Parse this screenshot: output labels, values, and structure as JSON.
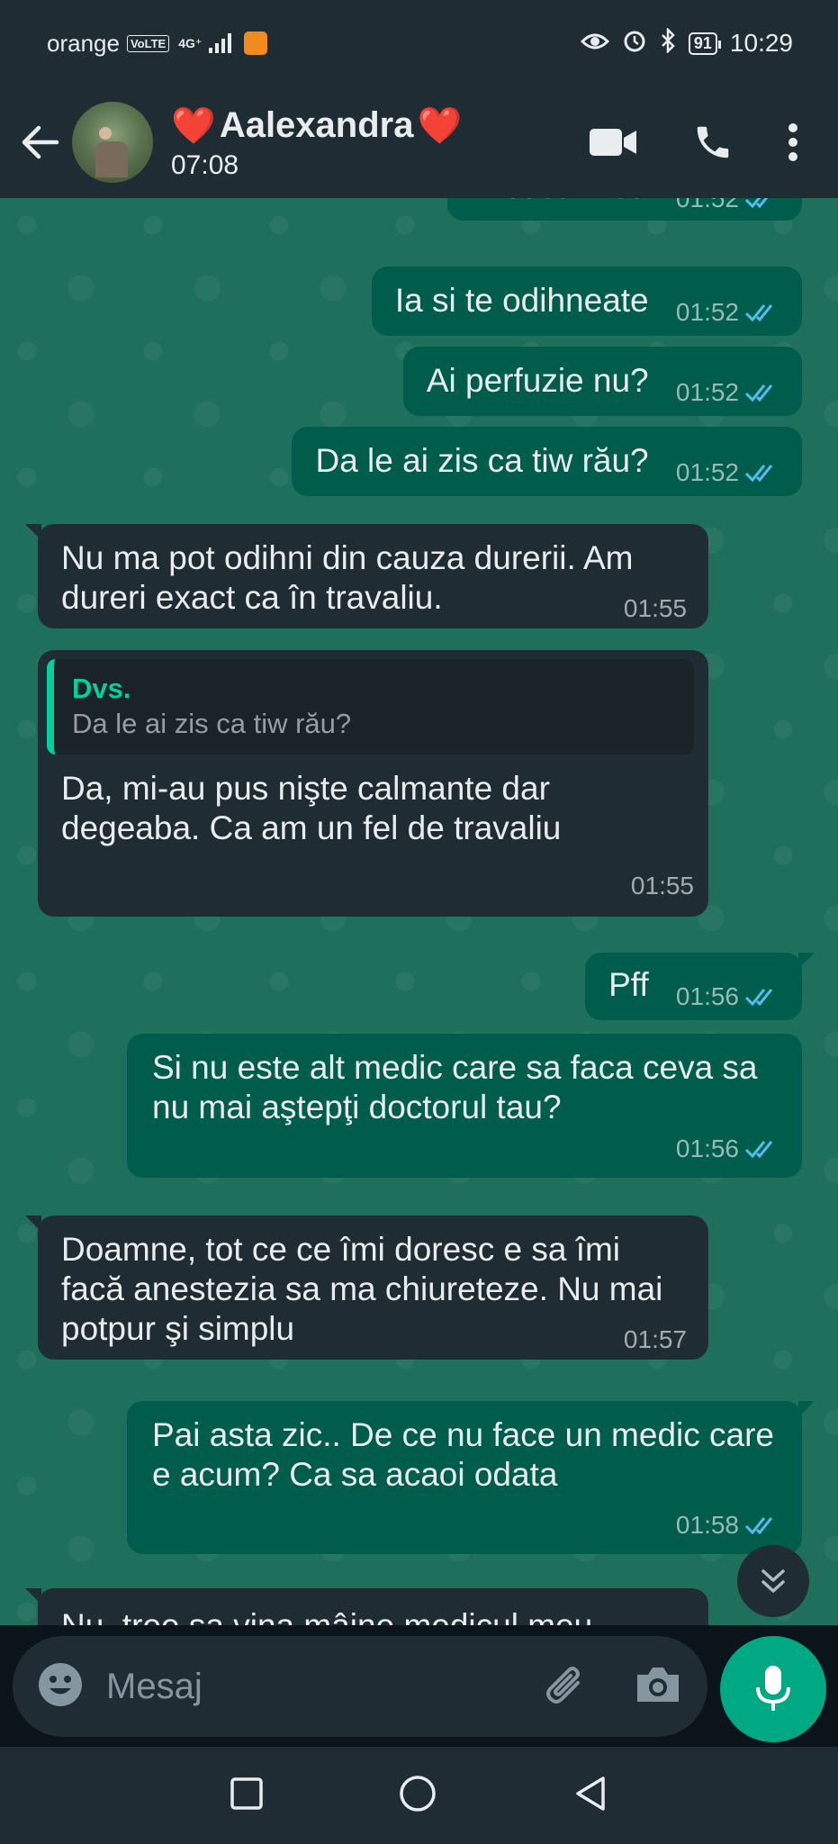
{
  "status_bar": {
    "carrier": "orange",
    "volte": "VoLTE",
    "network": "4G⁺",
    "battery": "91",
    "time": "10:29"
  },
  "header": {
    "heart_left": "❤️",
    "contact_name": "Aalexandra",
    "heart_right": "❤️",
    "last_seen": "07:08"
  },
  "messages": [
    {
      "dir": "out",
      "text": "Mititica mea",
      "time": "01:52"
    },
    {
      "dir": "out",
      "text": "Ia si te odihneate",
      "time": "01:52"
    },
    {
      "dir": "out",
      "text": "Ai perfuzie nu?",
      "time": "01:52"
    },
    {
      "dir": "out",
      "text": "Da le ai zis ca tiw rău?",
      "time": "01:52"
    },
    {
      "dir": "in",
      "text": "Nu ma pot odihni din cauza durerii. Am dureri exact ca în travaliu.",
      "time": "01:55"
    },
    {
      "dir": "in",
      "quote_author": "Dvs.",
      "quote_text": "Da le ai zis ca tiw rău?",
      "text": "Da, mi-au pus nişte calmante dar degeaba. Ca am un fel de travaliu",
      "time": "01:55"
    },
    {
      "dir": "out",
      "text": "Pff",
      "time": "01:56"
    },
    {
      "dir": "out",
      "text": "Si nu este alt medic care sa faca ceva sa nu mai aştepţi doctorul tau?",
      "time": "01:56"
    },
    {
      "dir": "in",
      "text": "Doamne, tot ce ce îmi doresc e sa îmi facă anestezia sa ma chiureteze. Nu mai potpur şi simplu",
      "time": "01:57"
    },
    {
      "dir": "out",
      "text": "Pai asta zic.. De ce nu face un medic care e acum? Ca sa acaoi odata",
      "time": "01:58"
    },
    {
      "dir": "in",
      "text": "Nu, tree sa vina mâine medicul meu",
      "time": ""
    }
  ],
  "input": {
    "placeholder": "Mesaj"
  },
  "icons": {
    "back": "arrow-left-icon",
    "video": "video-camera-icon",
    "call": "phone-icon",
    "menu": "more-vertical-icon",
    "emoji": "emoji-icon",
    "attach": "paperclip-icon",
    "camera": "camera-icon",
    "mic": "microphone-icon",
    "scroll": "double-chevron-down-icon"
  },
  "colors": {
    "accent": "#00a884",
    "outgoing_bubble": "#005c4b",
    "incoming_bubble": "#202c33",
    "read_ticks": "#53bdeb",
    "quote_author": "#06cf9c"
  }
}
